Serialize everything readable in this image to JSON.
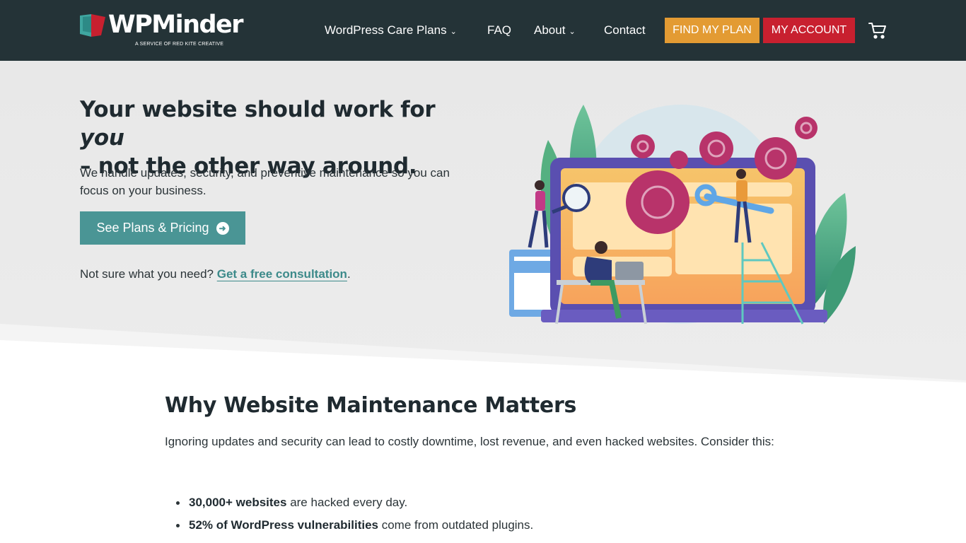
{
  "header": {
    "logo_text": "WPMinder",
    "logo_subtitle": "A SERVICE OF RED KITE CREATIVE",
    "nav": [
      {
        "label": "WordPress Care Plans",
        "has_dropdown": true
      },
      {
        "label": "FAQ",
        "has_dropdown": false
      },
      {
        "label": "About",
        "has_dropdown": true
      },
      {
        "label": "Contact",
        "has_dropdown": false
      }
    ],
    "dropdown_glyph": "⌄",
    "find_plan_label": "FIND MY PLAN",
    "my_account_label": "MY ACCOUNT",
    "cart_icon": "cart-icon"
  },
  "hero": {
    "title_part1": "Your website should work for ",
    "title_emphasis": "you",
    "title_part2": "– not the other way around.",
    "lead": "We handle updates, security, and preventive maintenance so you can focus on your business.",
    "cta_label": "See Plans & Pricing",
    "cta_icon": "arrow-circle-right-icon",
    "consult_prefix": "Not sure what you need? ",
    "consult_link": "Get a free consultation",
    "consult_suffix": "."
  },
  "section": {
    "title": "Why Website Maintenance Matters",
    "lead": "Ignoring updates and security can lead to costly downtime, lost revenue, and even hacked websites. Consider this:",
    "stats": [
      {
        "bold": "30,000+ websites",
        "rest": " are hacked every day."
      },
      {
        "bold": "52% of WordPress vulnerabilities",
        "rest": " come from outdated plugins."
      }
    ]
  },
  "colors": {
    "header_bg": "#243337",
    "accent_teal": "#4a9595",
    "find_plan_orange": "#e39b33",
    "account_red": "#c8202f",
    "hero_bg": "#e8e8e8"
  }
}
